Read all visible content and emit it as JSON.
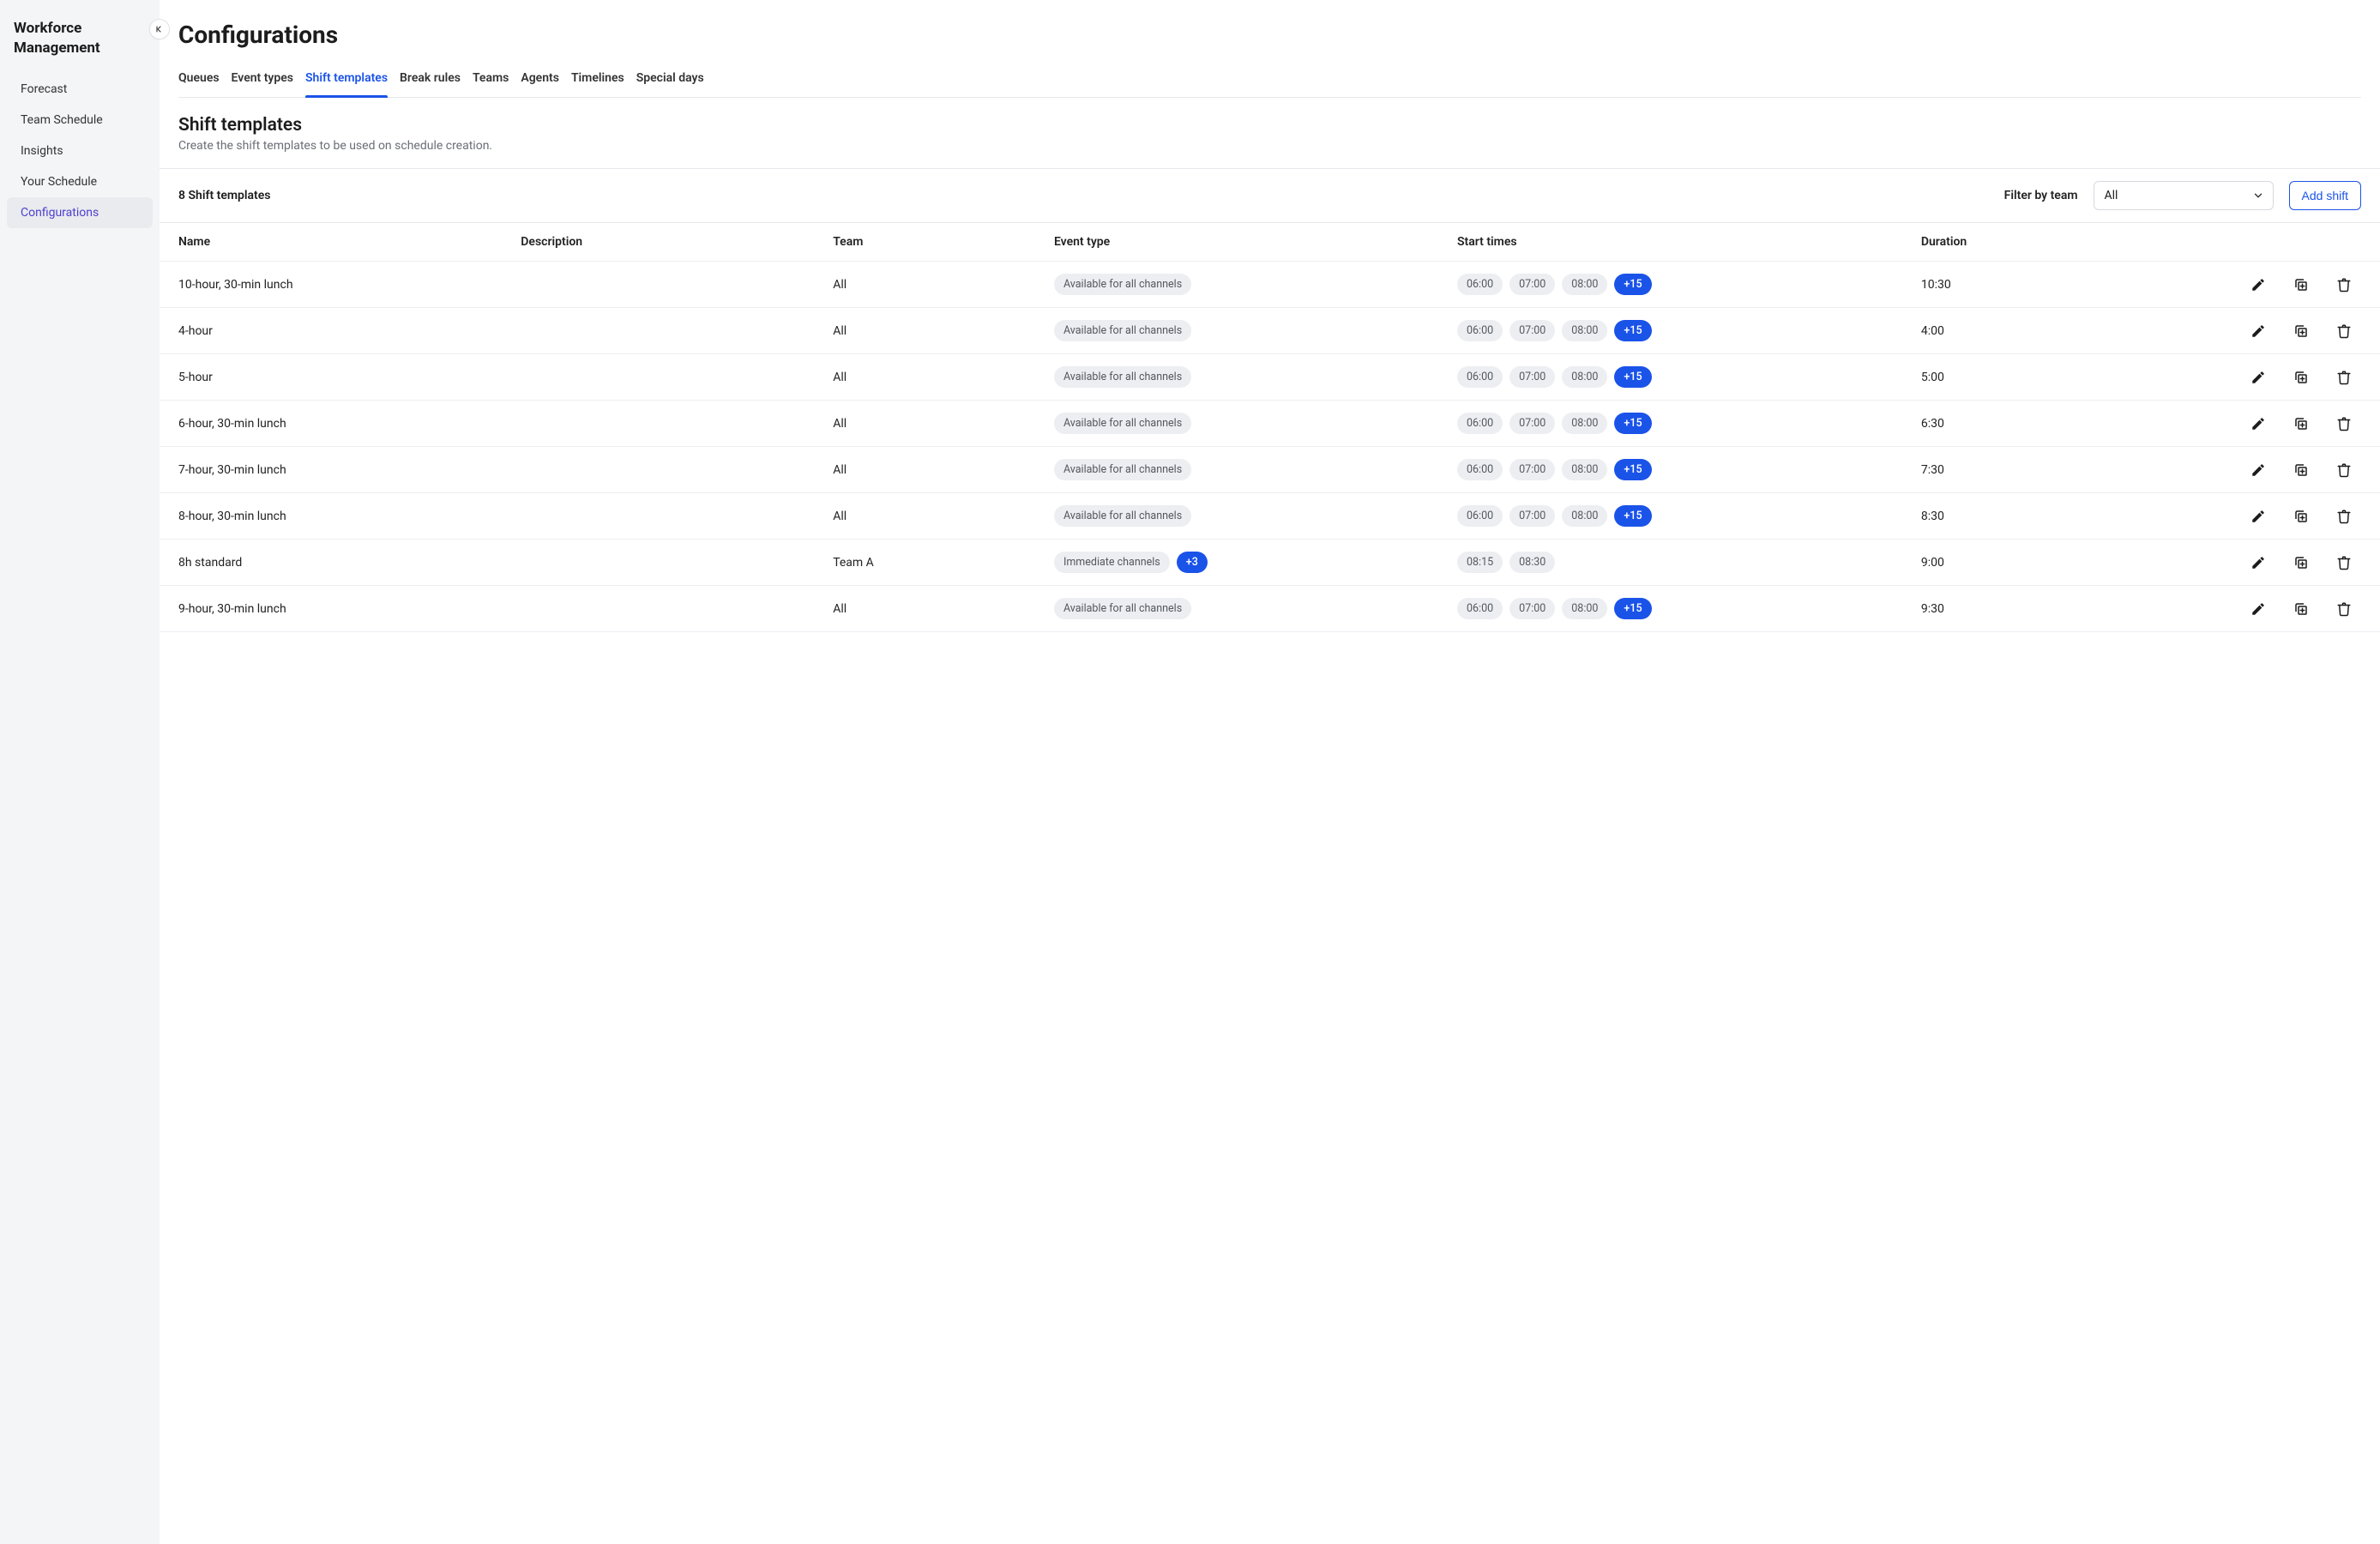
{
  "app_title": "Workforce Management",
  "sidebar": {
    "items": [
      {
        "label": "Forecast",
        "active": false
      },
      {
        "label": "Team Schedule",
        "active": false
      },
      {
        "label": "Insights",
        "active": false
      },
      {
        "label": "Your Schedule",
        "active": false
      },
      {
        "label": "Configurations",
        "active": true
      }
    ]
  },
  "page": {
    "title": "Configurations",
    "tabs": [
      {
        "label": "Queues",
        "active": false
      },
      {
        "label": "Event types",
        "active": false
      },
      {
        "label": "Shift templates",
        "active": true
      },
      {
        "label": "Break rules",
        "active": false
      },
      {
        "label": "Teams",
        "active": false
      },
      {
        "label": "Agents",
        "active": false
      },
      {
        "label": "Timelines",
        "active": false
      },
      {
        "label": "Special days",
        "active": false
      }
    ]
  },
  "section": {
    "title": "Shift templates",
    "description": "Create the shift templates to be used on schedule creation."
  },
  "toolbar": {
    "count_label": "8 Shift templates",
    "filter_label": "Filter by team",
    "filter_value": "All",
    "add_button": "Add shift"
  },
  "columns": {
    "name": "Name",
    "description": "Description",
    "team": "Team",
    "event_type": "Event type",
    "start_times": "Start times",
    "duration": "Duration"
  },
  "rows": [
    {
      "name": "10-hour, 30-min lunch",
      "description": "",
      "team": "All",
      "event_type": {
        "label": "Available for all channels",
        "extra": null
      },
      "start_times": [
        "06:00",
        "07:00",
        "08:00"
      ],
      "start_times_extra": "+15",
      "duration": "10:30"
    },
    {
      "name": "4-hour",
      "description": "",
      "team": "All",
      "event_type": {
        "label": "Available for all channels",
        "extra": null
      },
      "start_times": [
        "06:00",
        "07:00",
        "08:00"
      ],
      "start_times_extra": "+15",
      "duration": "4:00"
    },
    {
      "name": "5-hour",
      "description": "",
      "team": "All",
      "event_type": {
        "label": "Available for all channels",
        "extra": null
      },
      "start_times": [
        "06:00",
        "07:00",
        "08:00"
      ],
      "start_times_extra": "+15",
      "duration": "5:00"
    },
    {
      "name": "6-hour, 30-min lunch",
      "description": "",
      "team": "All",
      "event_type": {
        "label": "Available for all channels",
        "extra": null
      },
      "start_times": [
        "06:00",
        "07:00",
        "08:00"
      ],
      "start_times_extra": "+15",
      "duration": "6:30"
    },
    {
      "name": "7-hour, 30-min lunch",
      "description": "",
      "team": "All",
      "event_type": {
        "label": "Available for all channels",
        "extra": null
      },
      "start_times": [
        "06:00",
        "07:00",
        "08:00"
      ],
      "start_times_extra": "+15",
      "duration": "7:30"
    },
    {
      "name": "8-hour, 30-min lunch",
      "description": "",
      "team": "All",
      "event_type": {
        "label": "Available for all channels",
        "extra": null
      },
      "start_times": [
        "06:00",
        "07:00",
        "08:00"
      ],
      "start_times_extra": "+15",
      "duration": "8:30"
    },
    {
      "name": "8h standard",
      "description": "",
      "team": "Team A",
      "event_type": {
        "label": "Immediate channels",
        "extra": "+3"
      },
      "start_times": [
        "08:15",
        "08:30"
      ],
      "start_times_extra": null,
      "duration": "9:00"
    },
    {
      "name": "9-hour, 30-min lunch",
      "description": "",
      "team": "All",
      "event_type": {
        "label": "Available for all channels",
        "extra": null
      },
      "start_times": [
        "06:00",
        "07:00",
        "08:00"
      ],
      "start_times_extra": "+15",
      "duration": "9:30"
    }
  ]
}
